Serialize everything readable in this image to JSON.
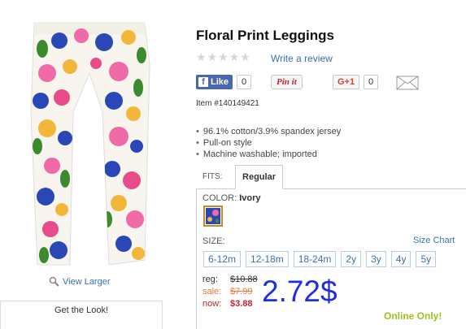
{
  "product": {
    "title": "Floral Print Leggings",
    "item_number": "Item #140149421",
    "features": [
      "96.1% cotton/3.9% spandex jersey",
      "Pull-on style",
      "Machine washable; imported"
    ]
  },
  "image": {
    "view_larger": "View Larger",
    "get_the_look": "Get the Look!"
  },
  "reviews": {
    "stars_filled": 0,
    "stars_total": 5,
    "write_review": "Write a review"
  },
  "social": {
    "fb_label": "Like",
    "fb_count": "0",
    "pinit_label": "Pin it",
    "gplus_label": "G+1",
    "gplus_count": "0"
  },
  "fits": {
    "label": "FITS:",
    "selected": "Regular"
  },
  "color": {
    "label": "COLOR:",
    "selected": "Ivory"
  },
  "size": {
    "label": "SIZE:",
    "chart_link": "Size Chart",
    "options": [
      "6-12m",
      "12-18m",
      "18-24m",
      "2y",
      "3y",
      "4y",
      "5y"
    ]
  },
  "pricing": {
    "reg_label": "reg:",
    "reg_value": "$10.88",
    "sale_label": "sale:",
    "sale_value": "$7.99",
    "now_label": "now:",
    "now_value": "$3.88",
    "big_price": "2.72$",
    "online_only": "Online Only!"
  },
  "colors": {
    "link": "#3a6fb3",
    "facebook": "#4a66ad",
    "sale": "#e8773a",
    "now": "#c8232c",
    "big_price": "#1e2de8",
    "online_only": "#9cc11a"
  }
}
